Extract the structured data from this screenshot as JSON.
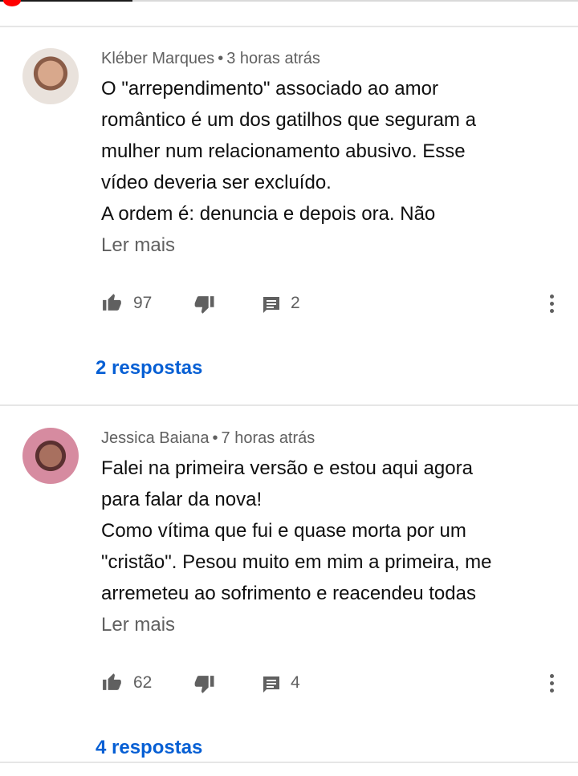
{
  "comments": [
    {
      "author": "Kléber Marques",
      "separator": "•",
      "time": "3 horas atrás",
      "lines": [
        "O \"arrependimento\" associado ao amor",
        "romântico é um dos gatilhos que seguram a",
        "mulher num relacionamento abusivo. Esse",
        "vídeo deveria ser excluído.",
        "A ordem é: denuncia e depois ora. Não"
      ],
      "read_more": "Ler mais",
      "likes": "97",
      "reply_count": "2",
      "replies_link": "2 respostas"
    },
    {
      "author": "Jessica Baiana",
      "separator": "•",
      "time": "7 horas atrás",
      "lines": [
        "Falei na primeira versão e estou aqui agora",
        "para falar da nova!",
        "Como vítima que fui e quase morta por um",
        "\"cristão\". Pesou muito em mim a primeira, me",
        "arremeteu ao sofrimento e reacendeu todas"
      ],
      "read_more": "Ler mais",
      "likes": "62",
      "reply_count": "4",
      "replies_link": "4 respostas"
    }
  ],
  "icons": {
    "like": "thumb-up-icon",
    "dislike": "thumb-down-icon",
    "reply": "comment-icon",
    "more": "more-vert-icon"
  },
  "colors": {
    "accent": "#065fd4",
    "progress": "#ff0000",
    "secondary_text": "#606060"
  }
}
